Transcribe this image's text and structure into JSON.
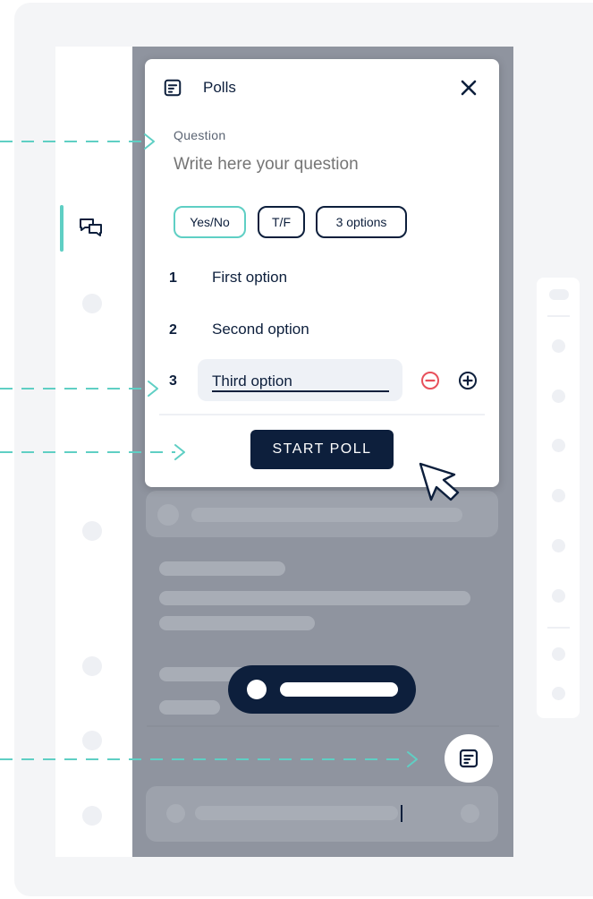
{
  "colors": {
    "accent": "#5fcfc4",
    "navy": "#0d1f3c",
    "danger": "#e8505b",
    "overlay": "#8f949f"
  },
  "poll_modal": {
    "header_icon": "poll-list-icon",
    "title": "Polls",
    "close_icon": "close-icon",
    "question_label": "Question",
    "question_placeholder": "Write here your question",
    "presets": [
      {
        "label": "Yes/No",
        "active": true
      },
      {
        "label": "T/F",
        "active": false
      },
      {
        "label": "3 options",
        "active": false
      }
    ],
    "options": [
      {
        "number": "1",
        "text": "First option"
      },
      {
        "number": "2",
        "text": "Second option"
      },
      {
        "number": "3",
        "text": "Third option"
      }
    ],
    "remove_option_icon": "minus-circle-icon",
    "add_option_icon": "plus-circle-icon",
    "start_button": "START POLL"
  },
  "sidebar": {
    "active_icon": "chat-bubbles-icon"
  },
  "floating_button_icon": "poll-list-icon"
}
